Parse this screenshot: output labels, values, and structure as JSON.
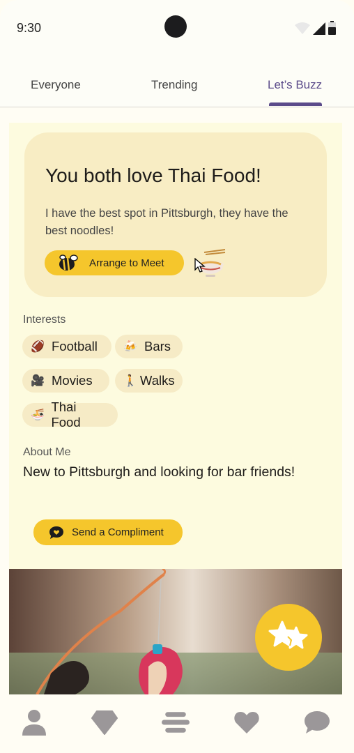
{
  "status_bar": {
    "time": "9:30"
  },
  "tabs": [
    {
      "label": "Everyone",
      "active": false
    },
    {
      "label": "Trending",
      "active": false
    },
    {
      "label": "Let’s Buzz",
      "active": true
    }
  ],
  "match_card": {
    "title": "You both love Thai Food!",
    "message": "I have the best spot in Pittsburgh, they have the best noodles!",
    "arrange_button": "Arrange to Meet",
    "icon": "noodle-bowl-icon"
  },
  "interests": {
    "label": "Interests",
    "items": [
      {
        "label": "Football",
        "icon": "football-icon",
        "glyph": "🏈"
      },
      {
        "label": "Bars",
        "icon": "bar-icon",
        "glyph": "🍻"
      },
      {
        "label": "Movies",
        "icon": "movie-camera-icon",
        "glyph": "🎥"
      },
      {
        "label": "Walks",
        "icon": "walking-icon",
        "glyph": "🚶"
      },
      {
        "label": "Thai Food",
        "icon": "noodle-bowl-icon",
        "glyph": "🍜"
      }
    ]
  },
  "about": {
    "label": "About Me",
    "text": "New to Pittsburgh and looking for bar friends!",
    "compliment_button": "Send a Compliment"
  },
  "colors": {
    "accent": "#f5c62c",
    "tab_active": "#5b4b8a",
    "card_bg": "#f8edc4",
    "panel_bg": "#fdfbdf",
    "nav_icon": "#9b9799"
  },
  "bottom_nav": [
    {
      "icon": "profile-icon"
    },
    {
      "icon": "discover-diamond-icon"
    },
    {
      "icon": "feed-menu-icon"
    },
    {
      "icon": "heart-icon"
    },
    {
      "icon": "chat-icon"
    }
  ]
}
